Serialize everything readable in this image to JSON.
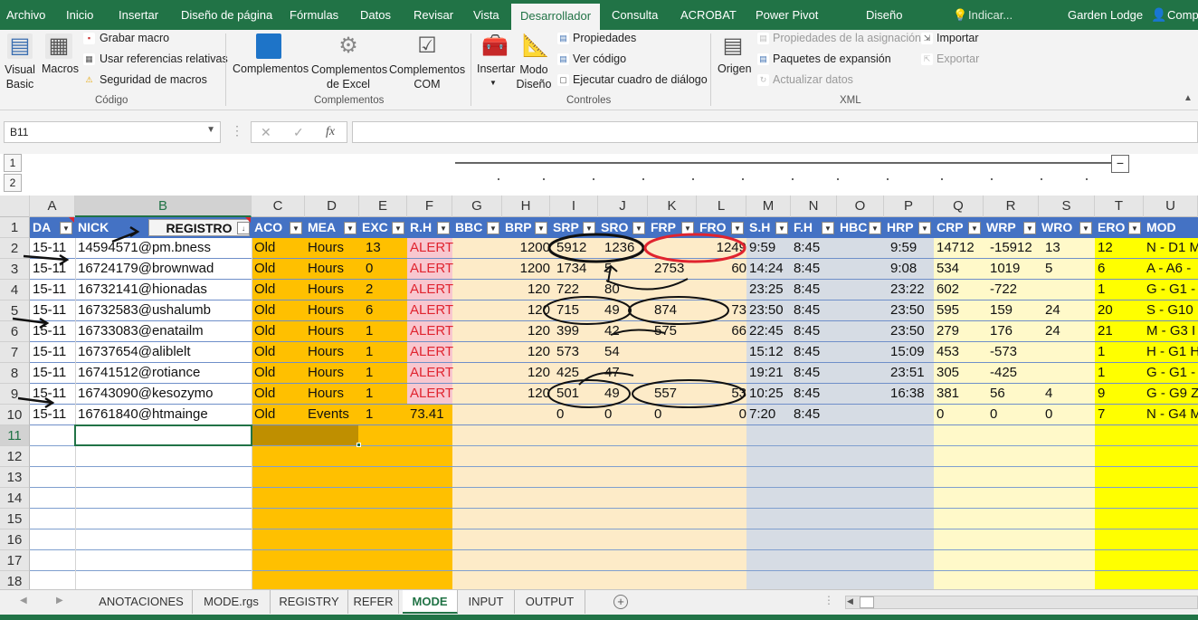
{
  "menu_tabs": [
    {
      "key": "archivo",
      "label": "Archivo"
    },
    {
      "key": "inicio",
      "label": "Inicio"
    },
    {
      "key": "insertar",
      "label": "Insertar"
    },
    {
      "key": "diseno-pagina",
      "label": "Diseño de página"
    },
    {
      "key": "formulas",
      "label": "Fórmulas"
    },
    {
      "key": "datos",
      "label": "Datos"
    },
    {
      "key": "revisar",
      "label": "Revisar"
    },
    {
      "key": "vista",
      "label": "Vista"
    },
    {
      "key": "desarrollador",
      "label": "Desarrollador"
    },
    {
      "key": "consulta",
      "label": "Consulta"
    },
    {
      "key": "acrobat",
      "label": "ACROBAT"
    },
    {
      "key": "power-pivot",
      "label": "Power Pivot"
    },
    {
      "key": "diseno",
      "label": "Diseño"
    }
  ],
  "indicar_placeholder": "Indicar...",
  "user": "Garden Lodge",
  "share": "Comp",
  "ribbon": {
    "visual_basic": [
      "Visual",
      "Basic"
    ],
    "macros": "Macros",
    "grabar_macro": "Grabar macro",
    "referencias_relativas": "Usar referencias relativas",
    "seguridad_macros": "Seguridad de macros",
    "group_codigo": "Código",
    "complementos": "Complementos",
    "complementos_excel": [
      "Complementos",
      "de Excel"
    ],
    "complementos_com": [
      "Complementos",
      "COM"
    ],
    "group_complementos": "Complementos",
    "insertar": "Insertar",
    "modo_diseno": [
      "Modo",
      "Diseño"
    ],
    "propiedades": "Propiedades",
    "ver_codigo": "Ver código",
    "ejecutar_cuadro": "Ejecutar cuadro de diálogo",
    "group_controles": "Controles",
    "origen": "Origen",
    "propiedades_asignacion": "Propiedades de la asignación",
    "paquetes_expansion": "Paquetes de expansión",
    "actualizar_datos": "Actualizar datos",
    "importar": "Importar",
    "exportar": "Exportar",
    "group_xml": "XML"
  },
  "name_box": "B11",
  "fx_label": "fx",
  "outline_levels": [
    "1",
    "2"
  ],
  "columns": [
    "A",
    "B",
    "C",
    "D",
    "E",
    "F",
    "G",
    "H",
    "I",
    "J",
    "K",
    "L",
    "M",
    "N",
    "O",
    "P",
    "Q",
    "R",
    "S",
    "T",
    "U"
  ],
  "row_numbers": [
    "1",
    "2",
    "3",
    "4",
    "5",
    "6",
    "7",
    "8",
    "9",
    "10",
    "11",
    "12",
    "13",
    "14",
    "15",
    "16",
    "17",
    "18"
  ],
  "headers": [
    "DA",
    "NICK",
    "REGISTRO",
    "ACO",
    "MEA",
    "EXC",
    "R.H",
    "BBC",
    "BRP",
    "SRP",
    "SRO",
    "FRP",
    "FRO",
    "S.H",
    "F.H",
    "HBC",
    "HRP",
    "CRP",
    "WRP",
    "WRO",
    "ERO",
    "MOD"
  ],
  "rows": [
    {
      "A": "15-11",
      "B": "14594571@pm.bness",
      "C": "Old",
      "D": "Hours",
      "E": "13",
      "F": "ALERT",
      "H": "1200",
      "I": "5912",
      "J": "1236",
      "L": "1249",
      "M": "9:59",
      "N": "8:45",
      "P": "9:59",
      "Q": "14712",
      "R": "-15912",
      "S": "13",
      "T": "12",
      "U": "N - D1 M"
    },
    {
      "A": "15-11",
      "B": "16724179@brownwad",
      "C": "Old",
      "D": "Hours",
      "E": "0",
      "F": "ALERT",
      "H": "1200",
      "I": "1734",
      "J": "5",
      "K": "2753",
      "L": "60",
      "M": "14:24",
      "N": "8:45",
      "P": "9:08",
      "Q": "534",
      "R": "1019",
      "S": "5",
      "T": "6",
      "U": "A - A6 -"
    },
    {
      "A": "15-11",
      "B": "16732141@hionadas",
      "C": "Old",
      "D": "Hours",
      "E": "2",
      "F": "ALERT",
      "H": "120",
      "I": "722",
      "J": "80",
      "M": "23:25",
      "N": "8:45",
      "P": "23:22",
      "Q": "602",
      "R": "-722",
      "T": "1",
      "U": "G - G1 -"
    },
    {
      "A": "15-11",
      "B": "16732583@ushalumb",
      "C": "Old",
      "D": "Hours",
      "E": "6",
      "F": "ALERT",
      "H": "120",
      "I": "715",
      "J": "49",
      "K": "874",
      "L": "73",
      "M": "23:50",
      "N": "8:45",
      "P": "23:50",
      "Q": "595",
      "R": "159",
      "S": "24",
      "T": "20",
      "U": "S - G10"
    },
    {
      "A": "15-11",
      "B": "16733083@enatailm",
      "C": "Old",
      "D": "Hours",
      "E": "1",
      "F": "ALERT",
      "H": "120",
      "I": "399",
      "J": "42",
      "K": "575",
      "L": "66",
      "M": "22:45",
      "N": "8:45",
      "P": "23:50",
      "Q": "279",
      "R": "176",
      "S": "24",
      "T": "21",
      "U": "M - G3 I"
    },
    {
      "A": "15-11",
      "B": "16737654@aliblelt",
      "C": "Old",
      "D": "Hours",
      "E": "1",
      "F": "ALERT",
      "H": "120",
      "I": "573",
      "J": "54",
      "M": "15:12",
      "N": "8:45",
      "P": "15:09",
      "Q": "453",
      "R": "-573",
      "T": "1",
      "U": "H - G1 H"
    },
    {
      "A": "15-11",
      "B": "16741512@rotiance",
      "C": "Old",
      "D": "Hours",
      "E": "1",
      "F": "ALERT",
      "H": "120",
      "I": "425",
      "J": "47",
      "M": "19:21",
      "N": "8:45",
      "P": "23:51",
      "Q": "305",
      "R": "-425",
      "T": "1",
      "U": "G - G1 -"
    },
    {
      "A": "15-11",
      "B": "16743090@kesozymo",
      "C": "Old",
      "D": "Hours",
      "E": "1",
      "F": "ALERT",
      "H": "120",
      "I": "501",
      "J": "49",
      "K": "557",
      "L": "53",
      "M": "10:25",
      "N": "8:45",
      "P": "16:38",
      "Q": "381",
      "R": "56",
      "S": "4",
      "T": "9",
      "U": "G - G9 Z"
    },
    {
      "A": "15-11",
      "B": "16761840@htmainge",
      "C": "Old",
      "D": "Events",
      "E": "1",
      "F": "73.41",
      "I": "0",
      "J": "0",
      "K": "0",
      "L": "0",
      "M": "7:20",
      "N": "8:45",
      "Q": "0",
      "R": "0",
      "S": "0",
      "T": "7",
      "U": "N - G4 M"
    }
  ],
  "sheet_tabs": [
    {
      "key": "anotaciones",
      "label": "ANOTACIONES"
    },
    {
      "key": "mode-rgs",
      "label": "MODE.rgs"
    },
    {
      "key": "registry",
      "label": "REGISTRY"
    },
    {
      "key": "refer",
      "label": "REFER"
    },
    {
      "key": "mode",
      "label": "MODE"
    },
    {
      "key": "input",
      "label": "INPUT"
    },
    {
      "key": "output",
      "label": "OUTPUT"
    }
  ],
  "active_sheet": "MODE",
  "colors": {
    "header_blue": "#4472c4",
    "orange": "#ffc000",
    "peach": "#fdebc8",
    "pink": "#f8c7cf",
    "grey_blue": "#d6dce4",
    "light_yellow": "#fff9c9",
    "yellow": "#ffff00",
    "excel_green": "#217346",
    "annotation_red": "#e0242f"
  }
}
